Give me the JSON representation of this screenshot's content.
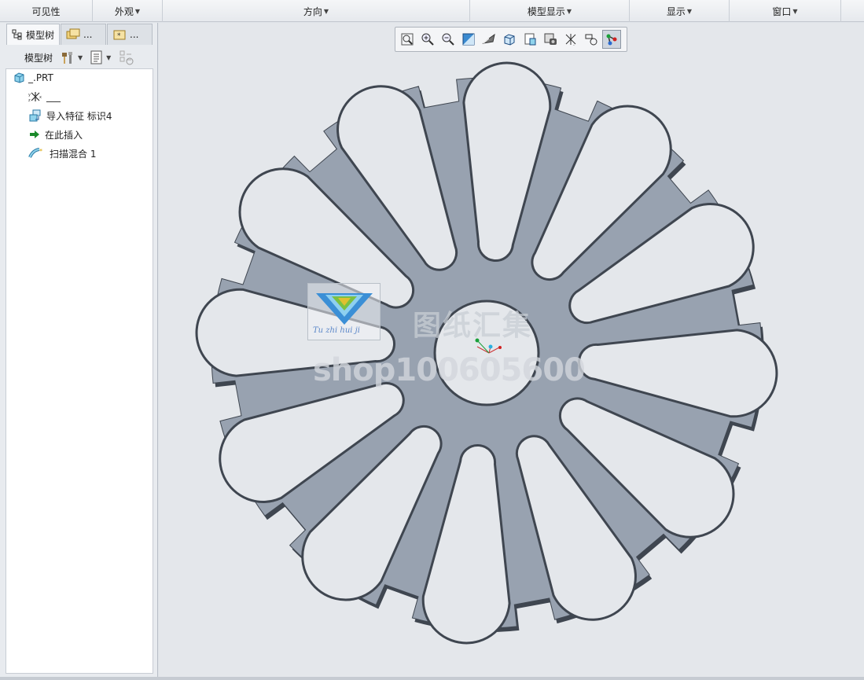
{
  "ribbon_groups": [
    {
      "label": "可见性",
      "has_menu": false
    },
    {
      "label": "外观",
      "has_menu": true
    },
    {
      "label": "方向",
      "has_menu": true
    },
    {
      "label": "模型显示",
      "has_menu": true
    },
    {
      "label": "显示",
      "has_menu": true
    },
    {
      "label": "窗口",
      "has_menu": true
    }
  ],
  "navigator": {
    "tabs": [
      {
        "label": "模型树",
        "icon": "model-tree-icon"
      },
      {
        "label": "...",
        "icon": "folder-browser-icon"
      },
      {
        "label": "...",
        "icon": "favorites-icon"
      }
    ],
    "toolbar": {
      "label": "模型树",
      "icons": [
        "settings-hammer-icon",
        "show-menu-icon",
        "filter-icon"
      ]
    },
    "tree": [
      {
        "label": "_.PRT",
        "icon": "part-icon",
        "indent": 0
      },
      {
        "label": "___",
        "icon": "csys-icon",
        "indent": 1
      },
      {
        "label": "导入特征 标识4",
        "icon": "import-feature-icon",
        "indent": 1
      },
      {
        "label": "在此插入",
        "icon": "insert-here-arrow-icon",
        "indent": 1
      },
      {
        "label": "扫描混合 1",
        "icon": "swept-blend-icon",
        "indent": 1
      }
    ]
  },
  "view_toolbar": {
    "icons": [
      "refit-icon",
      "zoom-in-icon",
      "zoom-out-icon",
      "repaint-icon",
      "perspective-icon",
      "display-style-icon",
      "saved-orientations-icon",
      "view-manager-icon",
      "datum-display-icon",
      "annotation-display-icon",
      "spin-center-icon"
    ],
    "active": "spin-center-icon"
  },
  "model": {
    "fill_color": "#98a2b0",
    "edge_color": "#3f4650",
    "slot_count": 12
  },
  "watermarks": {
    "chinese_text": "图纸汇集",
    "shop_text": "shop100605600",
    "logo_caption": "Tu zhi hui ji"
  }
}
